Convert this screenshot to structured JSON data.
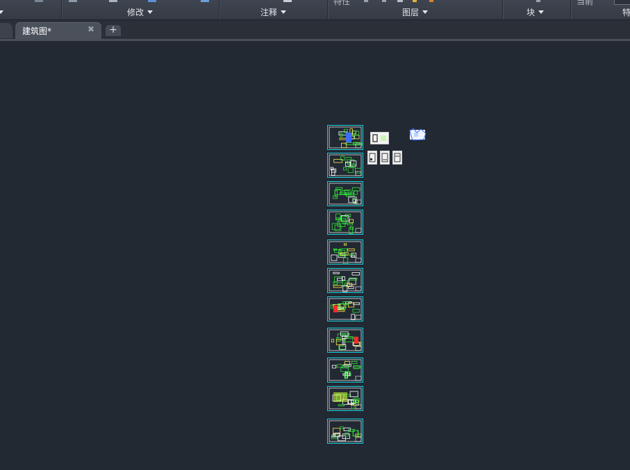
{
  "ribbon": {
    "clipped_text": {
      "properties": "特性",
      "current": "当前",
      "far_right": "特"
    },
    "panels": [
      {
        "id": "modify",
        "label": "修改"
      },
      {
        "id": "annotate",
        "label": "注释"
      },
      {
        "id": "layers",
        "label": "图层"
      },
      {
        "id": "block",
        "label": "块"
      }
    ]
  },
  "tabs": {
    "active": {
      "label": "建筑图*",
      "close_glyph": "✖"
    },
    "new_tab_glyph": "+"
  },
  "drawing": {
    "background": "#222933",
    "sheet_border_color": "#18d4e0",
    "sheet_count": 11,
    "small_sheet_count": 4,
    "stray_object_count": 1
  },
  "icons": {
    "caret": "chevron-down-icon",
    "close": "close-icon",
    "new_tab": "plus-icon"
  }
}
